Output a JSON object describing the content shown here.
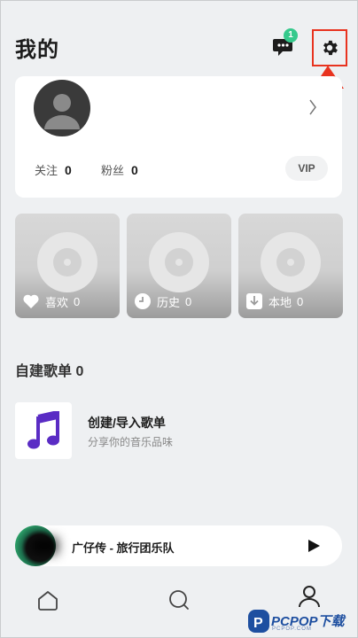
{
  "header": {
    "title": "我的",
    "message_badge": "1"
  },
  "profile": {
    "follow_label": "关注",
    "follow_count": "0",
    "fans_label": "粉丝",
    "fans_count": "0",
    "vip_label": "VIP"
  },
  "tiles": [
    {
      "label": "喜欢",
      "count": "0",
      "icon": "heart-icon"
    },
    {
      "label": "历史",
      "count": "0",
      "icon": "clock-icon"
    },
    {
      "label": "本地",
      "count": "0",
      "icon": "download-icon"
    }
  ],
  "playlists": {
    "section_title": "自建歌单 0",
    "create_title": "创建/导入歌单",
    "create_subtitle": "分享你的音乐品味"
  },
  "player": {
    "track": "广仔传 - 旅行团乐队"
  },
  "nav": [
    "home-icon",
    "search-icon",
    "profile-icon"
  ],
  "watermark": {
    "text": "PCPOP下载",
    "sub": "PCPOP.COM"
  },
  "colors": {
    "badge": "#35c98c",
    "highlight": "#e8331f",
    "note": "#5a2cc4"
  }
}
